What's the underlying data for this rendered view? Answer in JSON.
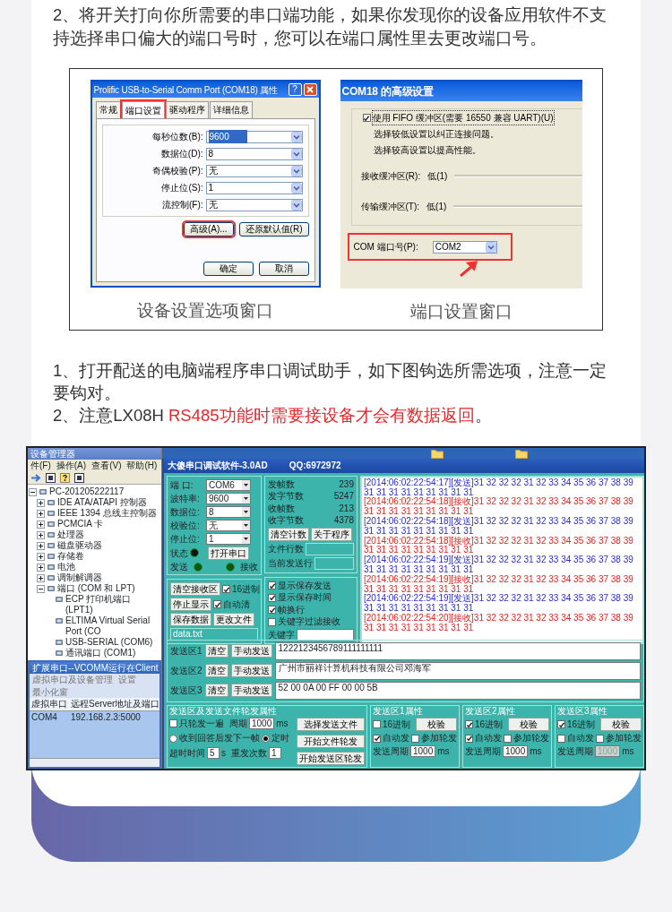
{
  "intro": {
    "text": "2、将开关打向你所需要的串口端功能，如果你发现你的设备应用软件不支持选择串口偏大的端口号时，您可以在端口属性里去更改端口号。"
  },
  "figure": {
    "port_dialog": {
      "title": "Prolific USB-to-Serial Comm Port (COM18) 属性",
      "help_button": "?",
      "tabs": [
        {
          "label": "常规",
          "selected": false,
          "highlighted": false
        },
        {
          "label": "端口设置",
          "selected": true,
          "highlighted": true
        },
        {
          "label": "驱动程序",
          "selected": false,
          "highlighted": false
        },
        {
          "label": "详细信息",
          "selected": false,
          "highlighted": false
        }
      ],
      "fields": [
        {
          "label": "每秒位数(B):",
          "value": "9600",
          "selected": true
        },
        {
          "label": "数据位(D):",
          "value": "8",
          "selected": false
        },
        {
          "label": "奇偶校验(P):",
          "value": "无",
          "selected": false
        },
        {
          "label": "停止位(S):",
          "value": "1",
          "selected": false
        },
        {
          "label": "流控制(F):",
          "value": "无",
          "selected": false
        }
      ],
      "buttons": [
        {
          "label": "高级(A)...",
          "highlighted": true
        },
        {
          "label": "还原默认值(R)",
          "highlighted": false
        }
      ],
      "footer_buttons": [
        "确定",
        "取消"
      ]
    },
    "advanced_dialog": {
      "title": "COM18 的高级设置",
      "fifo": {
        "label": "使用 FIFO 缓冲区(需要 16550 兼容 UART)(U)",
        "checked": true
      },
      "notes": [
        "选择较低设置以纠正连接问题。",
        "选择较高设置以提高性能。"
      ],
      "buffers": [
        {
          "label": "接收缓冲区(R):",
          "value": "低(1)"
        },
        {
          "label": "传输缓冲区(T):",
          "value": "低(1)"
        }
      ],
      "port": {
        "label": "COM 端口号(P):",
        "value": "COM2",
        "highlighted": true
      }
    },
    "captions": [
      "设备设置选项窗口",
      "端口设置窗口"
    ]
  },
  "instructions": [
    {
      "segments": [
        {
          "text": "1、打开配送的电脑端程序串口调试助手，如下图钩选所需选项，注意一定要钩对。",
          "emphasis": false
        }
      ]
    },
    {
      "segments": [
        {
          "text": "2、注意LX08H ",
          "emphasis": false
        },
        {
          "text": "RS485功能时需要接设备才会有数据返回",
          "emphasis": true
        },
        {
          "text": "。",
          "emphasis": false
        }
      ]
    }
  ],
  "screenshot": {
    "device_manager": {
      "title": "设备管理器",
      "menu": [
        "件(F)",
        "操作(A)",
        "查看(V)",
        "帮助(H)"
      ],
      "tree": [
        {
          "label": "PC-201205222117",
          "expanded": true,
          "children": [
            {
              "label": "IDE ATA/ATAPI 控制器",
              "expanded": false
            },
            {
              "label": "IEEE 1394 总线主控制器",
              "expanded": false
            },
            {
              "label": "PCMCIA 卡",
              "expanded": false
            },
            {
              "label": "处理器",
              "expanded": false
            },
            {
              "label": "磁盘驱动器",
              "expanded": false
            },
            {
              "label": "存储卷",
              "expanded": false
            },
            {
              "label": "电池",
              "expanded": false
            },
            {
              "label": "调制解调器",
              "expanded": false
            },
            {
              "label": "端口 (COM 和 LPT)",
              "expanded": true,
              "children": [
                {
                  "label": "ECP 打印机端口 (LPT1)"
                },
                {
                  "label": "ELTIMA Virtual Serial Port (CO"
                },
                {
                  "label": "USB-SERIAL (COM6)"
                },
                {
                  "label": "通讯端口 (COM1)"
                }
              ]
            }
          ]
        }
      ]
    },
    "vcomm": {
      "title": "扩展串口--VCOMM运行在Client",
      "menu": [
        "虚拟串口及设备管理",
        "设置",
        "最小化窗"
      ],
      "columns": [
        "虚拟串口",
        "远程Server地址及端口"
      ],
      "rows": [
        [
          "COM4",
          "192.168.2.3:5000"
        ]
      ]
    },
    "app": {
      "title": "大傻串口调试软件-3.0AD",
      "qq": "QQ:6972972",
      "port_settings": [
        {
          "label": "端 口:",
          "value": "COM6"
        },
        {
          "label": "波特率:",
          "value": "9600"
        },
        {
          "label": "数据位:",
          "value": "8"
        },
        {
          "label": "校验位:",
          "value": "无"
        },
        {
          "label": "停止位:",
          "value": "1"
        }
      ],
      "status": {
        "label": "状态",
        "on": false
      },
      "open_button": "打开串口",
      "send_indicator": {
        "label": "发送",
        "on": false
      },
      "receive_indicator": {
        "label": "接收",
        "on": false
      },
      "counters": [
        {
          "label": "发帧数",
          "value": "239"
        },
        {
          "label": "发字节数",
          "value": "5247"
        },
        {
          "label": "收帧数",
          "value": "213"
        },
        {
          "label": "收字节数",
          "value": "4378"
        }
      ],
      "counter_buttons": [
        "清空计数",
        "关于程序"
      ],
      "file_fields": [
        {
          "label": "文件行数"
        },
        {
          "label": "当前发送行"
        }
      ],
      "receive": {
        "buttons": [
          "清空接收区",
          "停止显示",
          "保存数据",
          "更改文件"
        ],
        "checks": [
          {
            "label": "16进制",
            "checked": true
          },
          {
            "label": "自动清",
            "checked": true
          }
        ],
        "file": "data.txt"
      },
      "display_options": [
        {
          "label": "显示保存发送",
          "checked": true
        },
        {
          "label": "显示保存时间",
          "checked": true
        },
        {
          "label": "帧换行",
          "checked": true
        },
        {
          "label": "关键字过滤接收",
          "checked": false
        }
      ],
      "keyword": {
        "label": "关键字"
      },
      "log": [
        {
          "kind": "send",
          "text": "[2014:06:02:22:54:17][发送]31 32 32 32 31 32 33 34 35 36 37 38 39 31 31 31 31 31 31 31 31 31"
        },
        {
          "kind": "receive",
          "text": "[2014:06:02:22:54:18][接收]31 32 32 32 31 32 33 34 35 36 37 38 39 31 31 31 31 31 31 31 31 31"
        },
        {
          "kind": "send",
          "text": "[2014:06:02:22:54:18][发送]31 32 32 32 31 32 33 34 35 36 37 38 39 31 31 31 31 31 31 31 31 31"
        },
        {
          "kind": "receive",
          "text": "[2014:06:02:22:54:18][接收]31 32 32 32 31 32 33 34 35 36 37 38 39 31 31 31 31 31 31 31 31 31"
        },
        {
          "kind": "send",
          "text": "[2014:06:02:22:54:19][发送]31 32 32 32 31 32 33 34 35 36 37 38 39 31 31 31 31 31 31 31 31 31"
        },
        {
          "kind": "receive",
          "text": "[2014:06:02:22:54:19][接收]31 32 32 32 31 32 33 34 35 36 37 38 39 31 31 31 31 31 31 31 31 31"
        },
        {
          "kind": "send",
          "text": "[2014:06:02:22:54:19][发送]31 32 32 32 31 32 33 34 35 36 37 38 39 31 31 31 31 31 31 31 31 31"
        },
        {
          "kind": "receive",
          "text": "[2014:06:02:22:54:20][接收]31 32 32 32 31 32 33 34 35 36 37 38 39 31 31 31 31 31 31 31 31 31"
        }
      ],
      "send_areas": [
        {
          "label": "发送区1",
          "clear": "清空",
          "send": "手动发送",
          "content": "1222123456789111111111"
        },
        {
          "label": "发送区2",
          "clear": "清空",
          "send": "手动发送",
          "content": "广州市丽祥计算机科技有限公司邓海军"
        },
        {
          "label": "发送区3",
          "clear": "清空",
          "send": "手动发送",
          "content": "52 00 0A 00 FF 00 00 5B"
        }
      ],
      "rotation": {
        "title": "发送区及发送文件轮发属性",
        "once": {
          "label": "只轮发一遍",
          "checked": false
        },
        "period": {
          "label": "周期",
          "value": "1000",
          "unit": "ms"
        },
        "modes": [
          {
            "label": "收到回答后发下一帧",
            "selected": false
          },
          {
            "label": "定时",
            "selected": true
          }
        ],
        "timeout": {
          "label": "超时时间",
          "value": "5",
          "unit": "s"
        },
        "retries": {
          "label": "重发次数",
          "value": "1"
        },
        "buttons": [
          "选择发送文件",
          "开始文件轮发",
          "开始发送区轮发"
        ]
      },
      "area_props": [
        {
          "title": "发送区1属性",
          "hex": {
            "label": "16进制",
            "checked": false
          },
          "verify": "校验",
          "auto": {
            "label": "自动发",
            "checked": true
          },
          "rotate": {
            "label": "参加轮发",
            "checked": false
          },
          "period": {
            "label": "发送周期",
            "value": "1000",
            "unit": "ms",
            "disabled": false
          }
        },
        {
          "title": "发送区2属性",
          "hex": {
            "label": "16进制",
            "checked": true
          },
          "verify": "校验",
          "auto": {
            "label": "自动发",
            "checked": true
          },
          "rotate": {
            "label": "参加轮发",
            "checked": false
          },
          "period": {
            "label": "发送周期",
            "value": "1000",
            "unit": "ms",
            "disabled": false
          }
        },
        {
          "title": "发送区3属性",
          "hex": {
            "label": "16进制",
            "checked": true
          },
          "verify": "校验",
          "auto": {
            "label": "自动发",
            "checked": false
          },
          "rotate": {
            "label": "参加轮发",
            "checked": false
          },
          "period": {
            "label": "发送周期",
            "value": "1000",
            "unit": "ms",
            "disabled": true
          }
        }
      ]
    }
  }
}
